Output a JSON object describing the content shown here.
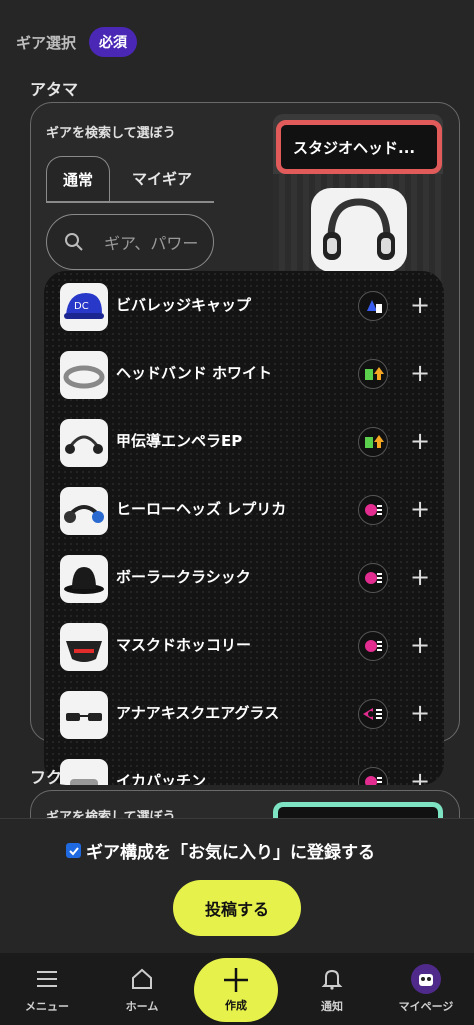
{
  "header": {
    "title": "ギア選択",
    "required_badge": "必須"
  },
  "section_head": {
    "label": "アタマ",
    "caption": "ギアを検索して選ぼう",
    "tabs": [
      "通常",
      "マイギア"
    ],
    "search_placeholder": "ギア、パワー",
    "selected_gear": "スタジオヘッド..."
  },
  "gear_list": [
    {
      "name": "ビバレッジキャップ",
      "ability_icon": "triangle-ink-icon",
      "color": "#2b49d6"
    },
    {
      "name": "ヘッドバンド ホワイト",
      "ability_icon": "ink-up-icon",
      "color": "#e8d53a"
    },
    {
      "name": "甲伝導エンペラEP",
      "ability_icon": "ink-up-icon",
      "color": "#e8d53a"
    },
    {
      "name": "ヒーローヘッズ レプリカ",
      "ability_icon": "run-icon",
      "color": "#e22c8f"
    },
    {
      "name": "ボーラークラシック",
      "ability_icon": "run-icon",
      "color": "#e22c8f"
    },
    {
      "name": "マスクドホッコリー",
      "ability_icon": "run-icon",
      "color": "#e22c8f"
    },
    {
      "name": "アナアキスクエアグラス",
      "ability_icon": "swim-icon",
      "color": "#e22c8f"
    },
    {
      "name": "イカパッチン",
      "ability_icon": "run-icon",
      "color": "#e22c8f"
    }
  ],
  "section_body": {
    "label": "フク",
    "caption": "ギアを検索して選ぼう"
  },
  "footer": {
    "favorite_label": "ギア構成を「お気に入り」に登録する",
    "favorite_checked": true,
    "post_button": "投稿する"
  },
  "nav": {
    "menu": "メニュー",
    "home": "ホーム",
    "create": "作成",
    "notify": "通知",
    "mypage": "マイページ"
  }
}
